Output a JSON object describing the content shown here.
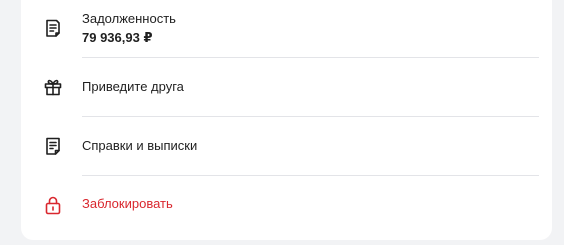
{
  "rows": [
    {
      "label": "Задолженность",
      "value": "79 936,93 ₽",
      "icon": "document-icon"
    },
    {
      "label": "Приведите друга",
      "icon": "gift-icon"
    },
    {
      "label": "Справки и выписки",
      "icon": "document-icon"
    },
    {
      "label": "Заблокировать",
      "icon": "lock-icon"
    }
  ],
  "colors": {
    "text": "#1f1f1f",
    "danger": "#d9272e",
    "divider": "#e3e4e8",
    "background": "#f2f3f5",
    "card": "#ffffff"
  }
}
